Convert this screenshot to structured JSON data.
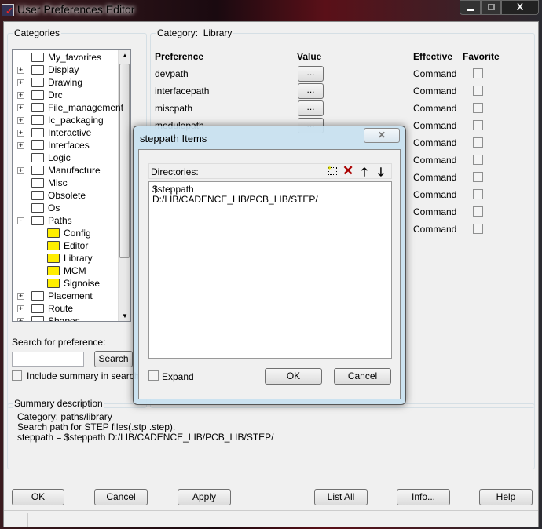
{
  "window": {
    "title": "User Preferences Editor",
    "controls": {
      "minimize": "minimize-icon",
      "maximize": "maximize-icon",
      "close": "close-icon"
    }
  },
  "categories": {
    "legend": "Categories",
    "items": [
      {
        "label": "My_favorites",
        "expander": "",
        "level": 0
      },
      {
        "label": "Display",
        "expander": "+",
        "level": 0
      },
      {
        "label": "Drawing",
        "expander": "+",
        "level": 0
      },
      {
        "label": "Drc",
        "expander": "+",
        "level": 0
      },
      {
        "label": "File_management",
        "expander": "+",
        "level": 0
      },
      {
        "label": "Ic_packaging",
        "expander": "+",
        "level": 0
      },
      {
        "label": "Interactive",
        "expander": "+",
        "level": 0
      },
      {
        "label": "Interfaces",
        "expander": "+",
        "level": 0
      },
      {
        "label": "Logic",
        "expander": "",
        "level": 0
      },
      {
        "label": "Manufacture",
        "expander": "+",
        "level": 0
      },
      {
        "label": "Misc",
        "expander": "",
        "level": 0
      },
      {
        "label": "Obsolete",
        "expander": "",
        "level": 0
      },
      {
        "label": "Os",
        "expander": "",
        "level": 0
      },
      {
        "label": "Paths",
        "expander": "-",
        "level": 0
      },
      {
        "label": "Config",
        "expander": "",
        "level": 1
      },
      {
        "label": "Editor",
        "expander": "",
        "level": 1
      },
      {
        "label": "Library",
        "expander": "",
        "level": 1
      },
      {
        "label": "MCM",
        "expander": "",
        "level": 1
      },
      {
        "label": "Signoise",
        "expander": "",
        "level": 1
      },
      {
        "label": "Placement",
        "expander": "+",
        "level": 0
      },
      {
        "label": "Route",
        "expander": "+",
        "level": 0
      },
      {
        "label": "Shapes",
        "expander": "+",
        "level": 0
      }
    ]
  },
  "search": {
    "label": "Search for preference:",
    "value": "",
    "button": "Search",
    "include_summary": "Include summary in search"
  },
  "category_panel": {
    "legend_prefix": "Category:",
    "legend_value": "Library",
    "headers": {
      "preference": "Preference",
      "value": "Value",
      "effective": "Effective",
      "favorite": "Favorite"
    },
    "rows": [
      {
        "name": "devpath",
        "value": "...",
        "effective": "Command"
      },
      {
        "name": "interfacepath",
        "value": "...",
        "effective": "Command"
      },
      {
        "name": "miscpath",
        "value": "...",
        "effective": "Command"
      },
      {
        "name": "modulepath",
        "value": "...",
        "effective": "Command"
      },
      {
        "name": "",
        "value": "",
        "effective": "Command"
      },
      {
        "name": "",
        "value": "",
        "effective": "Command"
      },
      {
        "name": "",
        "value": "",
        "effective": "Command"
      },
      {
        "name": "",
        "value": "",
        "effective": "Command"
      },
      {
        "name": "",
        "value": "",
        "effective": "Command"
      },
      {
        "name": "",
        "value": "",
        "effective": "Command"
      }
    ]
  },
  "summary": {
    "legend": "Summary description",
    "lines": [
      "Category: paths/library",
      "Search path for STEP files(.stp .step).",
      "steppath = $steppath D:/LIB/CADENCE_LIB/PCB_LIB/STEP/"
    ]
  },
  "buttons": {
    "ok": "OK",
    "cancel": "Cancel",
    "apply": "Apply",
    "list_all": "List All",
    "info": "Info...",
    "help": "Help"
  },
  "dialog": {
    "title": "steppath Items",
    "directories_label": "Directories:",
    "items": [
      "$steppath",
      "D:/LIB/CADENCE_LIB/PCB_LIB/STEP/"
    ],
    "expand": "Expand",
    "ok": "OK",
    "cancel": "Cancel"
  }
}
